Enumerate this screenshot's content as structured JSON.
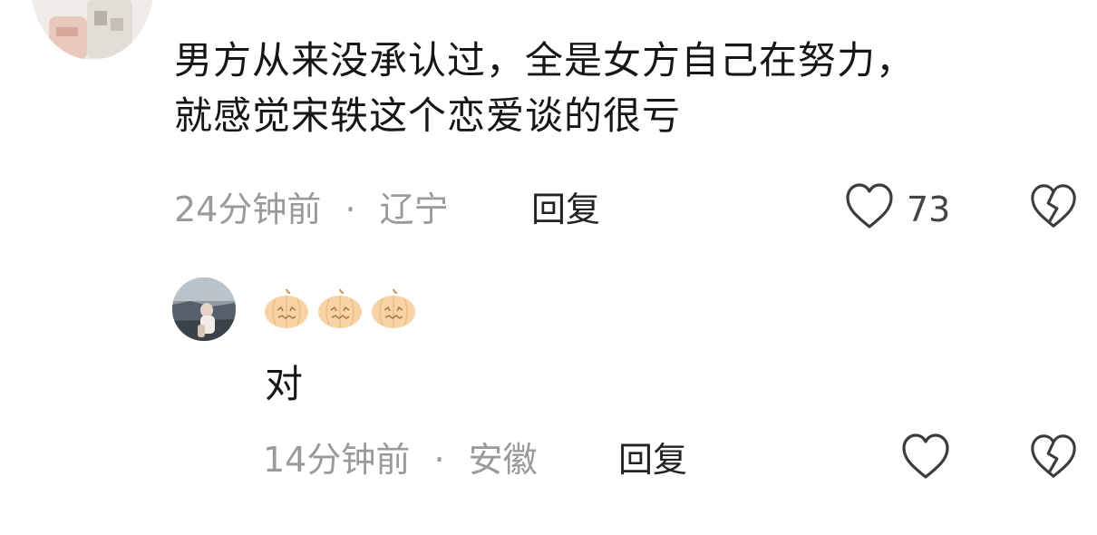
{
  "comment_top": {
    "text_lines": [
      "男方从来没承认过，全是女方自己在努力，",
      "就感觉宋轶这个恋爱谈的很亏"
    ],
    "time": "24分钟前",
    "separator": "·",
    "location": "辽宁",
    "reply_label": "回复",
    "like_count": "73",
    "like_icon": "heart-outline-icon",
    "dislike_icon": "broken-heart-icon"
  },
  "comment_reply": {
    "username_emojis": [
      "pumpkin-emoji",
      "pumpkin-emoji",
      "pumpkin-emoji"
    ],
    "text": "对",
    "time": "14分钟前",
    "separator": "·",
    "location": "安徽",
    "reply_label": "回复",
    "like_icon": "heart-outline-icon",
    "dislike_icon": "broken-heart-icon"
  },
  "colors": {
    "text": "#161616",
    "meta": "#9a9a9a",
    "icon": "#3c3c3c",
    "pumpkin": "#f7d3a6"
  }
}
